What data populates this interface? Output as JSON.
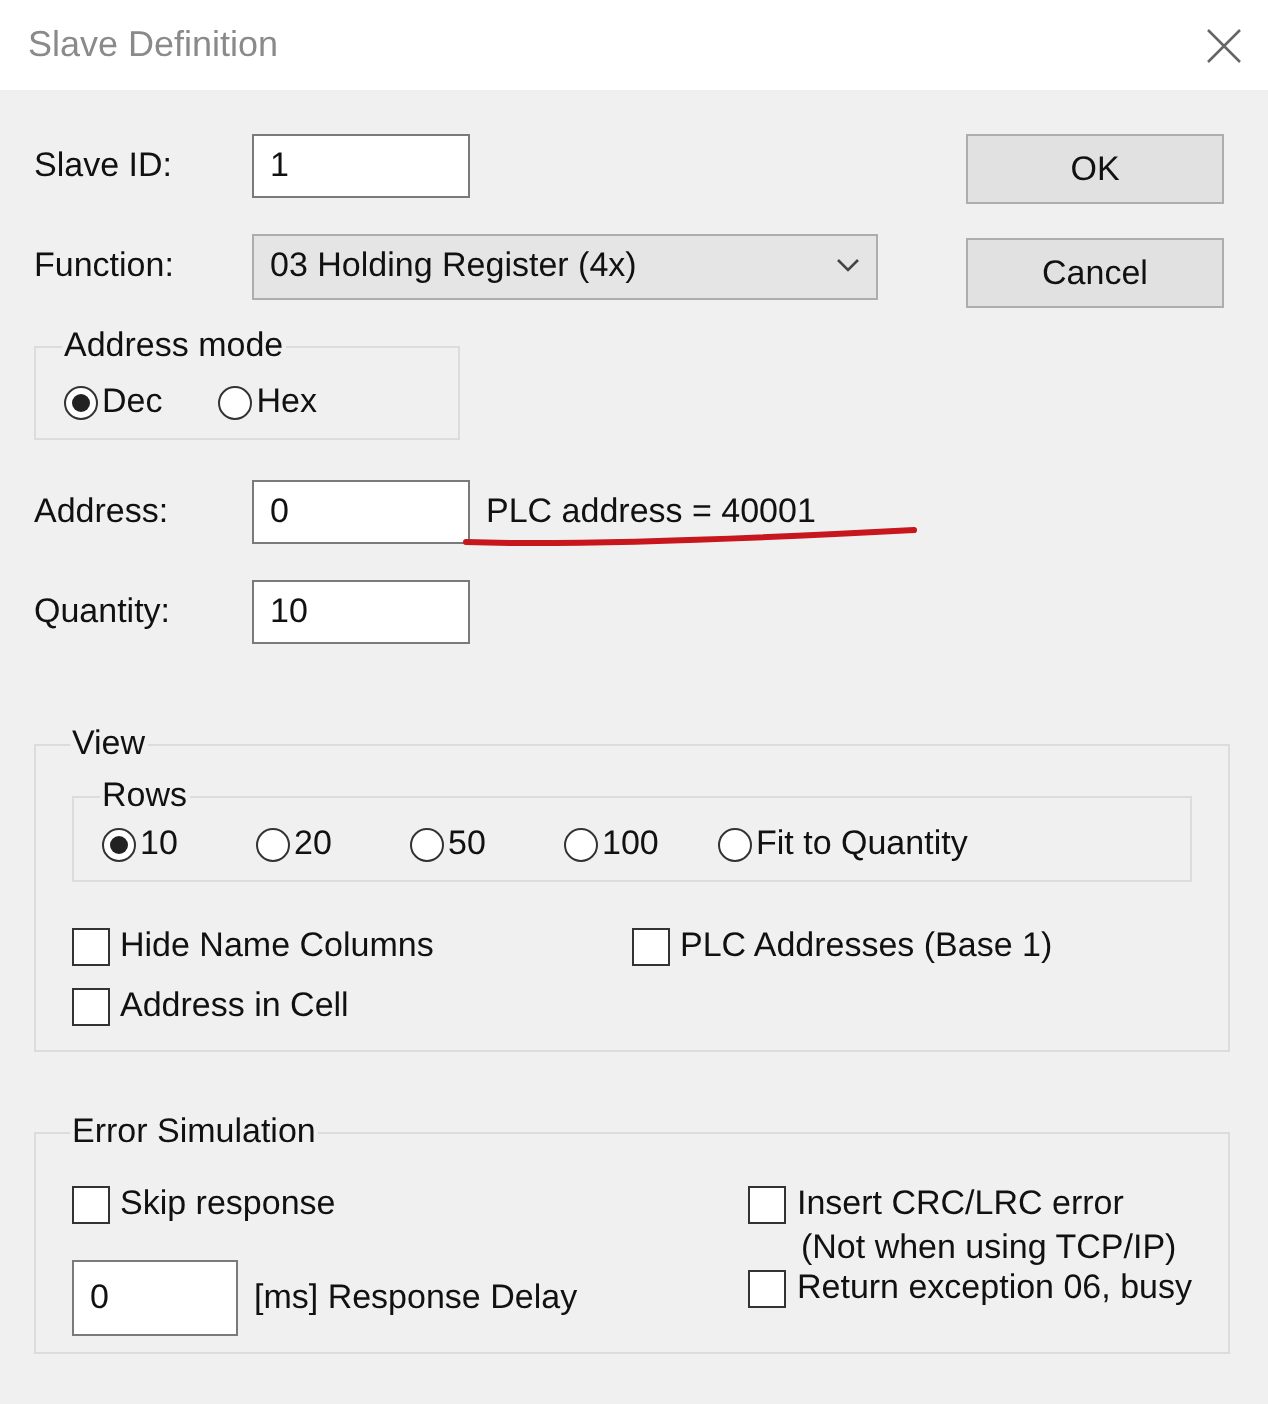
{
  "window": {
    "title": "Slave Definition"
  },
  "slave_id": {
    "label": "Slave ID:",
    "value": "1"
  },
  "function": {
    "label": "Function:",
    "value": "03 Holding Register (4x)"
  },
  "buttons": [
    "OK",
    "Cancel"
  ],
  "address_mode": {
    "title": "Address mode",
    "options": [
      {
        "label": "Dec",
        "selected": true
      },
      {
        "label": "Hex",
        "selected": false
      }
    ]
  },
  "address": {
    "label": "Address:",
    "value": "0",
    "note": "PLC address = 40001",
    "underlined": true
  },
  "quantity": {
    "label": "Quantity:",
    "value": "10"
  },
  "view": {
    "title": "View",
    "rows": {
      "title": "Rows",
      "options": [
        {
          "label": "10",
          "selected": true
        },
        {
          "label": "20",
          "selected": false
        },
        {
          "label": "50",
          "selected": false
        },
        {
          "label": "100",
          "selected": false
        },
        {
          "label": "Fit to Quantity",
          "selected": false
        }
      ]
    },
    "checkboxes": [
      {
        "label": "Hide Name Columns",
        "checked": false
      },
      {
        "label": "PLC Addresses (Base 1)",
        "checked": false
      },
      {
        "label": "Address in Cell",
        "checked": false
      }
    ]
  },
  "error_simulation": {
    "title": "Error Simulation",
    "skip_response": {
      "label": "Skip response",
      "checked": false
    },
    "response_delay": {
      "value": "0",
      "label": "[ms] Response Delay"
    },
    "insert_crc": {
      "label": "Insert CRC/LRC error",
      "note": "(Not when using TCP/IP)",
      "checked": false
    },
    "return_exception": {
      "label": "Return exception 06, busy",
      "checked": false
    }
  }
}
